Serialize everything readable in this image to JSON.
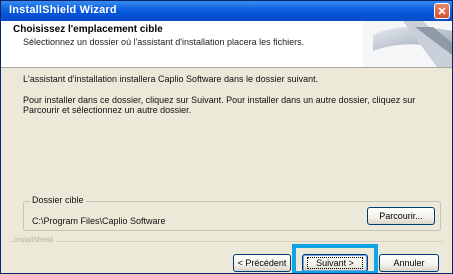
{
  "window": {
    "title": "InstallShield Wizard"
  },
  "header": {
    "title": "Choisissez l'emplacement cible",
    "subtitle": "Sélectionnez un dossier où l'assistant d'installation placera les fichiers."
  },
  "body": {
    "intro": "L'assistant d'installation installera Caplio Software dans le dossier suivant.",
    "instructions": "Pour installer dans ce dossier, cliquez sur Suivant. Pour installer dans un autre dossier, cliquez sur Parcourir et sélectionnez un autre dossier."
  },
  "destination": {
    "legend": "Dossier cible",
    "path": "C:\\Program Files\\Caplio Software",
    "browse_label": "Parcourir..."
  },
  "footer": {
    "brand": "InstallShield",
    "back_label": "< Précédent",
    "next_label": "Suivant >",
    "cancel_label": "Annuler"
  },
  "icons": {
    "close": "close-icon",
    "header_graphic": "installshield-banner-graphic"
  },
  "colors": {
    "titlebar": "#0a5ee0",
    "dialog_bg": "#ece9d8",
    "highlight": "#10a4e4"
  }
}
